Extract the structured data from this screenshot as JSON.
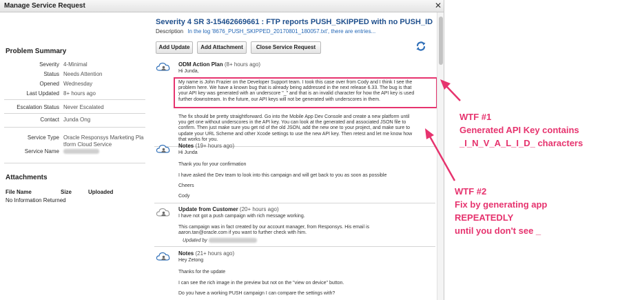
{
  "dialog": {
    "title": "Manage Service Request",
    "close_glyph": "✕"
  },
  "summary": {
    "heading": "Problem Summary",
    "severity_label": "Severity",
    "severity_value": "4-Minimal",
    "status_label": "Status",
    "status_value": "Needs Attention",
    "opened_label": "Opened",
    "opened_value": "Wednesday",
    "updated_label": "Last Updated",
    "updated_value": "8+ hours ago",
    "escalation_label": "Escalation Status",
    "escalation_value": "Never Escalated",
    "contact_label": "Contact",
    "contact_value": "Junda Ong",
    "service_type_label": "Service Type",
    "service_type_line1": "Oracle Responsys Marketing Pla",
    "service_type_line2": "tform Cloud Service",
    "service_name_label": "Service Name"
  },
  "attachments": {
    "heading": "Attachments",
    "col_file": "File Name",
    "col_size": "Size",
    "col_uploaded": "Uploaded",
    "empty": "No Information Returned"
  },
  "sr": {
    "title": "Severity 4  SR 3-15462669661 : FTP reports PUSH_SKIPPED with no PUSH_ID",
    "description_label": "Description",
    "description_text": "In the log '8676_PUSH_SKIPPED_20170801_180057.txt', there are entries...",
    "buttons": {
      "add_update": "Add Update",
      "add_attachment": "Add Attachment",
      "close_sr": "Close Service Request"
    }
  },
  "entries": {
    "e1": {
      "title": "ODM Action Plan",
      "when": "(8+ hours ago)",
      "greeting": "Hi Junda,",
      "p1": [
        "My name is John Frazier on the Developer Support team. I took this case over from Cody and I think I see the",
        "problem here. We have a known bug that is already being addressed in the next release 6.33. The bug is that",
        "your API key was generated with an underscore \"_\" and that is an invalid character for how the API key is used",
        "further downstream. In the future, our API keys will not be generated with underscores in them."
      ],
      "p2": [
        "The fix should be pretty straightforward. Go into the Mobile App Dev Console and create a new platform until",
        "you get one without underscores in the API key. You can look at the generated and associated JSON file to",
        "confirm. Then just make sure you get rid of the old JSON, add the new one to your project, and make sure to",
        "update your URL Scheme and other Xcode settings to use the new API key. Then retest and let me know how",
        "that works for you."
      ]
    },
    "e2": {
      "title": "Notes",
      "when": "(19+ hours ago)",
      "greeting": "Hi Junda",
      "p1": "Thank you for your confirmation",
      "p2": "I have asked the Dev team to look into this campaign and will get back to you as soon as possible",
      "p3": "Cheers",
      "p4": "Cody"
    },
    "e3": {
      "title": "Update from Customer",
      "when": "(20+ hours ago)",
      "p1": "I have not got a push campaign with rich message working.",
      "p2": [
        "This campaign was in fact created by our account manager, from Responsys. His email is",
        "aaron.tan@oracle.com if you want to further check with him."
      ],
      "updated_by": "Updated by"
    },
    "e4": {
      "title": "Notes",
      "when": "(21+ hours ago)",
      "greeting": "Hey Zetong",
      "p1": "Thanks for the update",
      "p2": "I can see the rich image in the preview but not on the \"view on device\" button.",
      "p3": "Do you have a working PUSH campaign I can compare the settings with?"
    }
  },
  "annotations": {
    "wtf1": [
      "WTF #1",
      "Generated API Key contains",
      "_I_N_V_A_L_I_D_ characters"
    ],
    "wtf2": [
      "WTF #2",
      "Fix by generating app",
      "REPEATEDLY",
      "until you don't see _"
    ]
  },
  "colors": {
    "annotation": "#e6336e",
    "title_blue": "#1f4f8c",
    "link_blue": "#2467b5",
    "icon_blue": "#2f6fb8"
  },
  "icons": {
    "refresh": "refresh-icon",
    "entry": "cloud-person-icon",
    "close": "close-icon"
  }
}
